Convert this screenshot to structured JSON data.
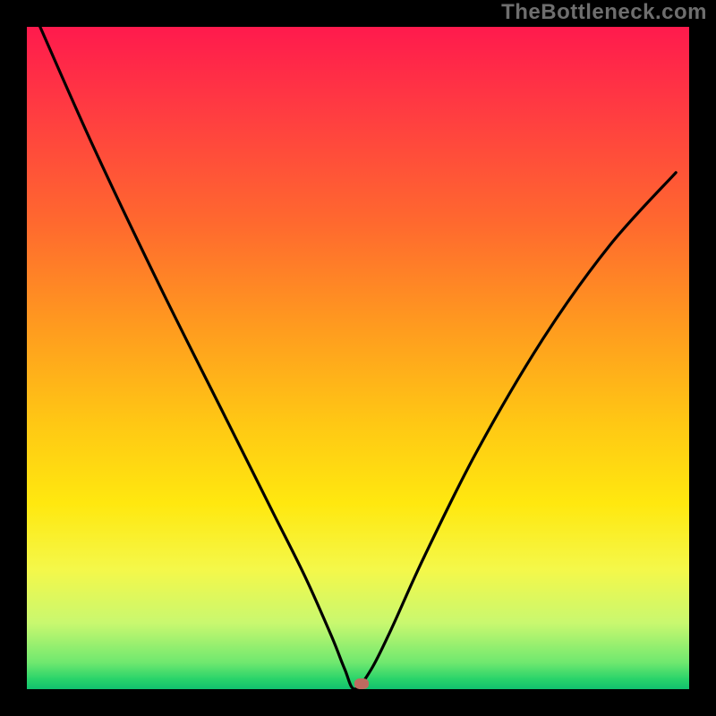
{
  "watermark": "TheBottleneck.com",
  "chart_data": {
    "type": "line",
    "title": "",
    "xlabel": "",
    "ylabel": "",
    "xlim": [
      0,
      1
    ],
    "ylim": [
      0,
      1
    ],
    "grid": false,
    "legend": false,
    "gradient_meaning": "vertical color gradient red(top)=high bottleneck, green(bottom)=low bottleneck",
    "series": [
      {
        "name": "bottleneck-curve",
        "x": [
          0.02,
          0.1,
          0.2,
          0.3,
          0.37,
          0.42,
          0.46,
          0.48,
          0.495,
          0.52,
          0.55,
          0.6,
          0.68,
          0.78,
          0.88,
          0.98
        ],
        "y": [
          1.0,
          0.82,
          0.61,
          0.41,
          0.27,
          0.17,
          0.08,
          0.03,
          0.0,
          0.03,
          0.09,
          0.2,
          0.36,
          0.53,
          0.67,
          0.78
        ]
      }
    ],
    "marker": {
      "x": 0.505,
      "y": 0.008,
      "color": "#be6a60"
    },
    "colors": {
      "background_frame": "#000000",
      "curve": "#000000",
      "gradient_top": "#ff1a4d",
      "gradient_bottom": "#11c06e",
      "watermark": "#6e6e6e"
    }
  }
}
